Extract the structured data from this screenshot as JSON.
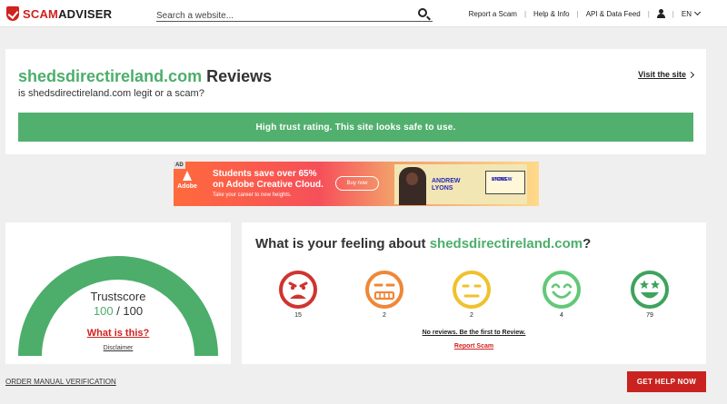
{
  "header": {
    "logo_text_red": "SCAM",
    "logo_text_dark": "ADVISER",
    "search_placeholder": "Search a website...",
    "nav": [
      "Report a Scam",
      "Help & Info",
      "API & Data Feed"
    ],
    "language": "EN"
  },
  "review": {
    "domain": "shedsdirectireland.com",
    "title_suffix": " Reviews",
    "subtitle": "is shedsdirectireland.com legit or a scam?",
    "visit_label": "Visit the site",
    "trust_message": "High trust rating. This site looks safe to use."
  },
  "ad": {
    "badge": "AD",
    "brand": "Adobe",
    "headline_line1": "Students save over 65%",
    "headline_line2": "on Adobe Creative Cloud.",
    "tagline": "Take your career to new heights.",
    "button": "Buy now",
    "person_name_line1": "ANDREW",
    "person_name_line2": "LYONS",
    "card_line1": "ANDREW",
    "card_line2": "LYONS"
  },
  "trustscore": {
    "label": "Trustscore",
    "score": "100",
    "max": " / 100",
    "score_fraction": 1.0,
    "what_is": "What is this?",
    "disclaimer": "Disclaimer"
  },
  "feeling": {
    "title_prefix": "What is your feeling about ",
    "domain": "shedsdirectireland.com",
    "title_suffix": "?",
    "faces": [
      {
        "name": "angry-face-icon",
        "color": "#d0332f",
        "count": "15"
      },
      {
        "name": "annoyed-face-icon",
        "color": "#ef8737",
        "count": "2"
      },
      {
        "name": "neutral-face-icon",
        "color": "#f1c12c",
        "count": "2"
      },
      {
        "name": "smiling-face-icon",
        "color": "#62c877",
        "count": "4"
      },
      {
        "name": "star-eyes-face-icon",
        "color": "#3ea35c",
        "count": "79"
      }
    ],
    "no_reviews": "No reviews. Be the first to Review.",
    "report": "Report Scam"
  },
  "footer": {
    "order_verification": "ORDER MANUAL VERIFICATION",
    "get_help": "GET HELP NOW"
  },
  "colors": {
    "brand_red": "#d0221f",
    "trust_green": "#4cae6a"
  }
}
